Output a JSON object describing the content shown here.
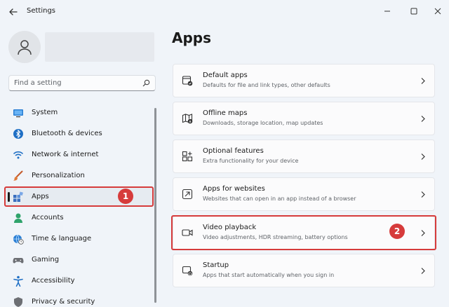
{
  "window": {
    "title": "Settings",
    "back_icon": "back-arrow-icon",
    "controls": [
      "minimize-icon",
      "maximize-icon",
      "close-icon"
    ]
  },
  "sidebar": {
    "search": {
      "placeholder": "Find a setting",
      "value": ""
    },
    "items": [
      {
        "label": "System",
        "icon": "monitor-icon",
        "selected": false
      },
      {
        "label": "Bluetooth & devices",
        "icon": "bluetooth-icon",
        "selected": false
      },
      {
        "label": "Network & internet",
        "icon": "wifi-icon",
        "selected": false
      },
      {
        "label": "Personalization",
        "icon": "brush-icon",
        "selected": false
      },
      {
        "label": "Apps",
        "icon": "apps-icon",
        "selected": true
      },
      {
        "label": "Accounts",
        "icon": "person-icon",
        "selected": false
      },
      {
        "label": "Time & language",
        "icon": "globe-clock-icon",
        "selected": false
      },
      {
        "label": "Gaming",
        "icon": "gamepad-icon",
        "selected": false
      },
      {
        "label": "Accessibility",
        "icon": "accessibility-icon",
        "selected": false
      },
      {
        "label": "Privacy & security",
        "icon": "shield-icon",
        "selected": false
      }
    ]
  },
  "main": {
    "title": "Apps",
    "cards": [
      {
        "title": "Default apps",
        "desc": "Defaults for file and link types, other defaults",
        "icon": "default-apps-icon"
      },
      {
        "title": "Offline maps",
        "desc": "Downloads, storage location, map updates",
        "icon": "map-icon"
      },
      {
        "title": "Optional features",
        "desc": "Extra functionality for your device",
        "icon": "add-feature-icon"
      },
      {
        "title": "Apps for websites",
        "desc": "Websites that can open in an app instead of a browser",
        "icon": "open-in-app-icon"
      },
      {
        "title": "Video playback",
        "desc": "Video adjustments, HDR streaming, battery options",
        "icon": "video-camera-icon"
      },
      {
        "title": "Startup",
        "desc": "Apps that start automatically when you sign in",
        "icon": "startup-icon"
      }
    ]
  },
  "annotations": {
    "callout_1": "1",
    "callout_2": "2",
    "color": "#d63b3b"
  },
  "colors": {
    "accent": "#0067c0",
    "highlight": "#d63b3b",
    "background": "#f0f4f9"
  }
}
